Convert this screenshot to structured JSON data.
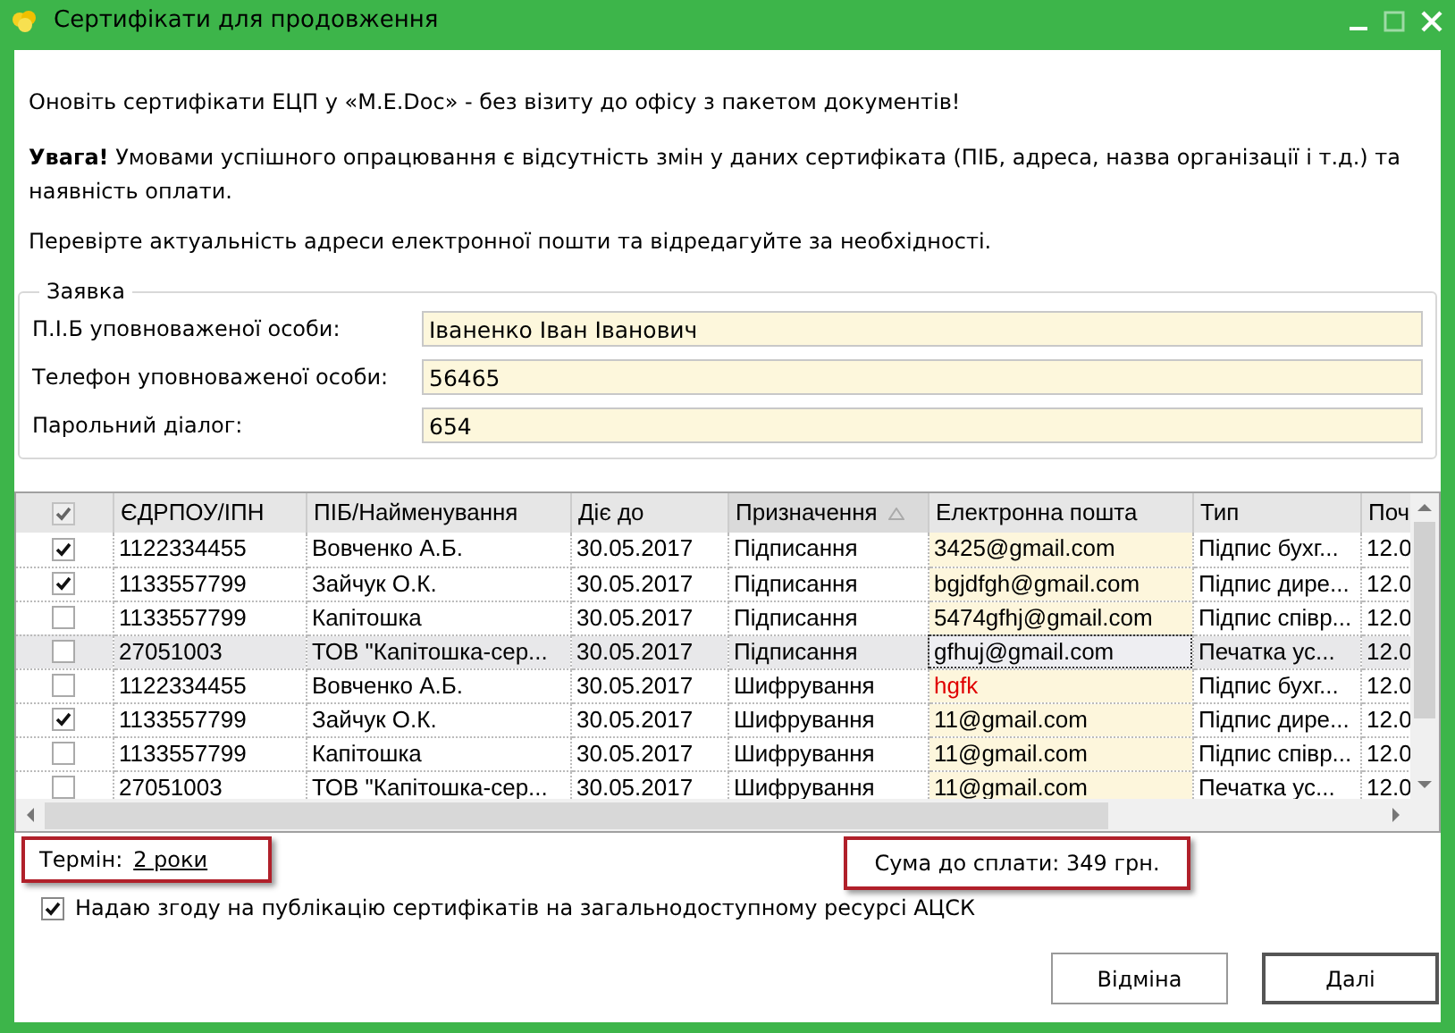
{
  "window": {
    "title": "Сертифікати для продовження"
  },
  "intro": "Оновіть сертифікати ЕЦП у «M.E.Doc» - без візиту до офісу з пакетом документів!",
  "warning": "**Увага!** Умовами успішного опрацювання є відсутність змін у даних сертифіката (ПІБ, адреса, назва організації і т.д.) та наявність оплати.",
  "hint": "Перевірте актуальність адреси електронної пошти та відредагуйте за необхідності.",
  "request": {
    "legend": "Заявка",
    "fields": [
      {
        "label": "П.І.Б уповноваженої особи:",
        "value": "Іваненко Іван Іванович"
      },
      {
        "label": "Телефон уповноваженої особи:",
        "value": "56465"
      },
      {
        "label": "Парольний діалог:",
        "value": "654"
      }
    ]
  },
  "table": {
    "select_all": {
      "checked": true
    },
    "columns": [
      {
        "label": "ЄДРПОУ/ІПН",
        "sorted": false
      },
      {
        "label": "ПІБ/Найменування",
        "sorted": false
      },
      {
        "label": "Діє до",
        "sorted": false
      },
      {
        "label": "Призначення",
        "sorted": true
      },
      {
        "label": "Електронна пошта",
        "sorted": false
      },
      {
        "label": "Тип",
        "sorted": false
      },
      {
        "label": "Поч",
        "sorted": false
      }
    ],
    "rows": [
      {
        "checked": true,
        "selected": false,
        "email_invalid": false,
        "cells": [
          "1122334455",
          "Вовченко А.Б.",
          "30.05.2017",
          "Підписання",
          "3425@gmail.com",
          "Підпис бухг...",
          "12.0"
        ]
      },
      {
        "checked": true,
        "selected": false,
        "email_invalid": false,
        "cells": [
          "1133557799",
          "Зайчук О.К.",
          "30.05.2017",
          "Підписання",
          "bgjdfgh@gmail.com",
          "Підпис дире...",
          "12.0"
        ]
      },
      {
        "checked": false,
        "selected": false,
        "email_invalid": false,
        "cells": [
          "1133557799",
          "Капітошка",
          "30.05.2017",
          "Підписання",
          "5474gfhj@gmail.com",
          "Підпис співр...",
          "12.0"
        ]
      },
      {
        "checked": false,
        "selected": true,
        "email_invalid": false,
        "cells": [
          "27051003",
          "ТОВ \"Капітошка-сер...",
          "30.05.2017",
          "Підписання",
          "gfhuj@gmail.com",
          "Печатка ус...",
          "12.0"
        ]
      },
      {
        "checked": false,
        "selected": false,
        "email_invalid": true,
        "cells": [
          "1122334455",
          "Вовченко А.Б.",
          "30.05.2017",
          "Шифрування",
          "hgfk",
          "Підпис бухг...",
          "12.0"
        ]
      },
      {
        "checked": true,
        "selected": false,
        "email_invalid": false,
        "cells": [
          "1133557799",
          "Зайчук О.К.",
          "30.05.2017",
          "Шифрування",
          "11@gmail.com",
          "Підпис дире...",
          "12.0"
        ]
      },
      {
        "checked": false,
        "selected": false,
        "email_invalid": false,
        "cells": [
          "1133557799",
          "Капітошка",
          "30.05.2017",
          "Шифрування",
          "11@gmail.com",
          "Підпис співр...",
          "12.0"
        ]
      },
      {
        "checked": false,
        "selected": false,
        "email_invalid": false,
        "cells": [
          "27051003",
          "ТОВ \"Капітошка-сер...",
          "30.05.2017",
          "Шифрування",
          "11@gmail.com",
          "Печатка ус...",
          "12.0"
        ]
      }
    ]
  },
  "term": {
    "label": "Термін:",
    "value": "2 роки"
  },
  "total": "Сума до сплати: 349 грн.",
  "consent": {
    "label": "Надаю згоду на публікацію сертифікатів на загальнодоступному ресурсі АЦСК",
    "checked": true
  },
  "buttons": [
    {
      "label": "Відміна",
      "default": false
    },
    {
      "label": "Далі",
      "default": true
    }
  ]
}
